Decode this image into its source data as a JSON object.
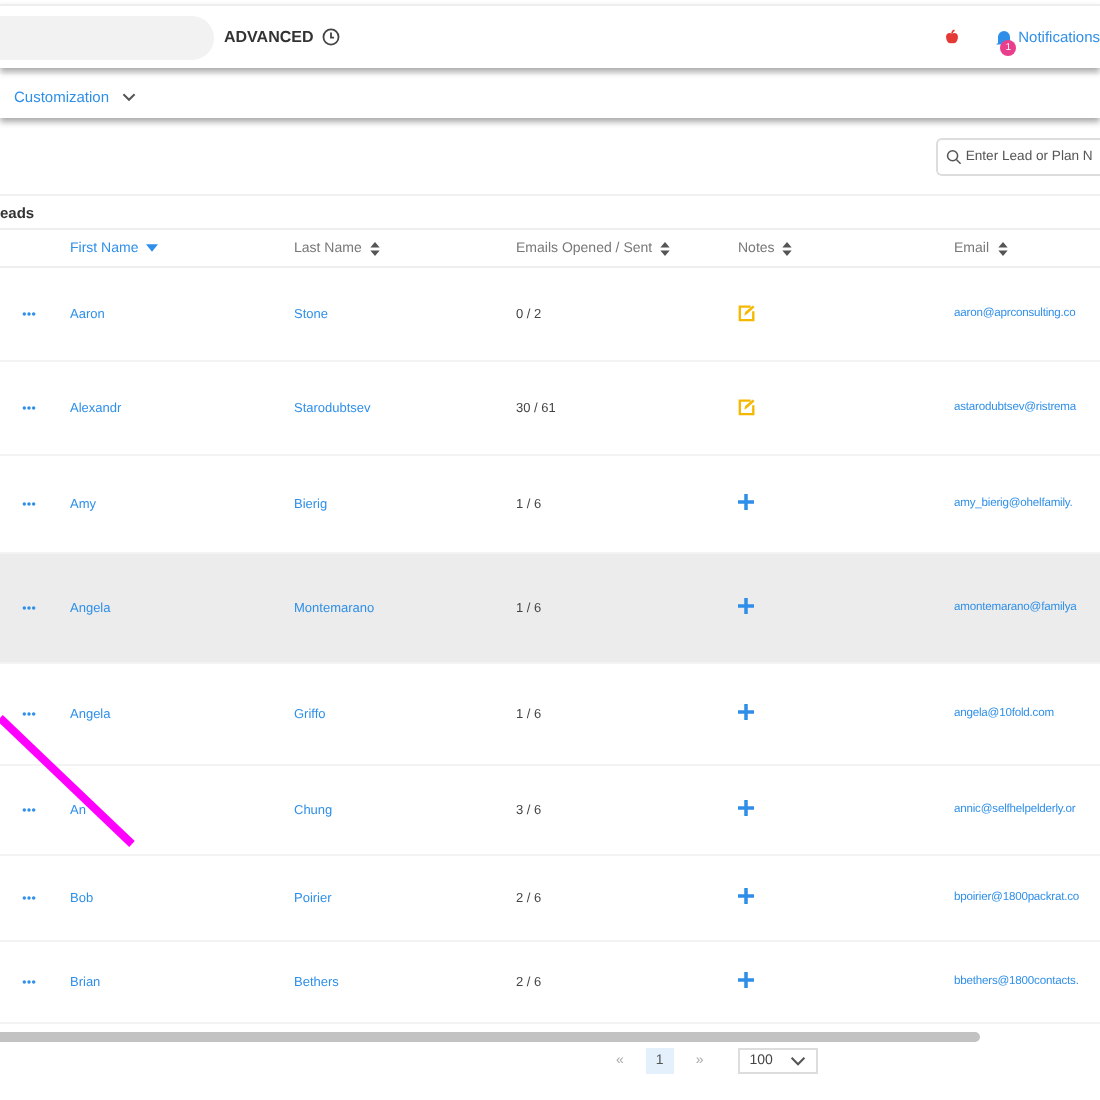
{
  "top_bar": {
    "plan": "ADVANCED",
    "notifications": {
      "label": "Notifications",
      "badge": "1"
    }
  },
  "sub_bar": {
    "menu": "Customization"
  },
  "search": {
    "placeholder": "Enter Lead or Plan N"
  },
  "table": {
    "title": "eads",
    "columns": [
      {
        "label": "First Name",
        "sorted": true
      },
      {
        "label": "Last Name",
        "sorted": false
      },
      {
        "label": "Emails Opened / Sent",
        "sorted": false
      },
      {
        "label": "Notes",
        "sorted": false
      },
      {
        "label": "Email",
        "sorted": false
      }
    ],
    "rows": [
      {
        "first": "Aaron",
        "last": "Stone",
        "emails": "0 / 2",
        "note": {
          "kind": "edit"
        },
        "email": "aaron@aprconsulting.co",
        "highlighted": false
      },
      {
        "first": "Alexandr",
        "last": "Starodubtsev",
        "emails": "30 / 61",
        "note": {
          "kind": "edit"
        },
        "email": "astarodubtsev@ristrema",
        "highlighted": false
      },
      {
        "first": "Amy",
        "last": "Bierig",
        "emails": "1 / 6",
        "note": {
          "kind": "add"
        },
        "email": "amy_bierig@ohelfamily.",
        "highlighted": false
      },
      {
        "first": "Angela",
        "last": "Montemarano",
        "emails": "1 / 6",
        "note": {
          "kind": "add"
        },
        "email": "amontemarano@familya",
        "highlighted": true
      },
      {
        "first": "Angela",
        "last": "Griffo",
        "emails": "1 / 6",
        "note": {
          "kind": "add"
        },
        "email": "angela@10fold.com",
        "highlighted": false
      },
      {
        "first": "An",
        "last": "Chung",
        "emails": "3 / 6",
        "note": {
          "kind": "add"
        },
        "email": "annic@selfhelpelderly.or",
        "highlighted": false
      },
      {
        "first": "Bob",
        "last": "Poirier",
        "emails": "2 / 6",
        "note": {
          "kind": "add"
        },
        "email": "bpoirier@1800packrat.co",
        "highlighted": false
      },
      {
        "first": "Brian",
        "last": "Bethers",
        "emails": "2 / 6",
        "note": {
          "kind": "add"
        },
        "email": "bbethers@1800contacts.",
        "highlighted": false
      }
    ]
  },
  "pagination": {
    "first": "«",
    "next": "»",
    "pages": [
      {
        "label": "1",
        "selected": true
      }
    ],
    "page_size": "100"
  }
}
